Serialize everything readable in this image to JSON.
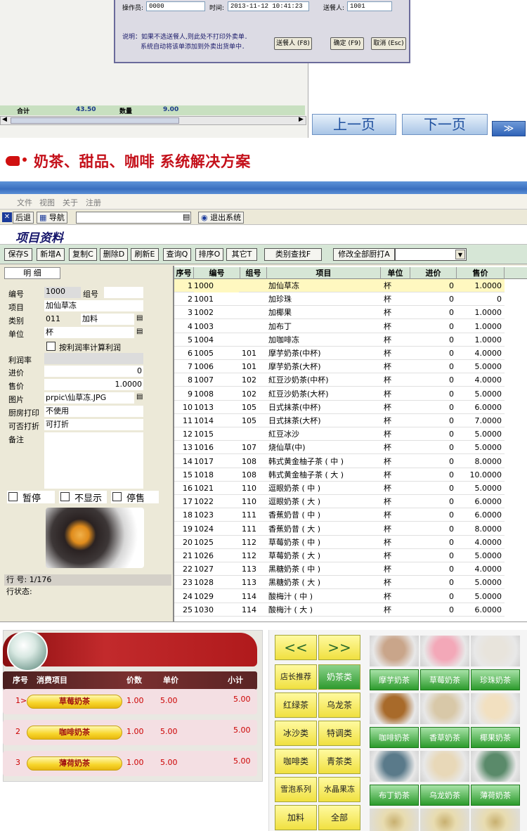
{
  "dialog": {
    "operator_label": "操作员:",
    "operator_value": "0000",
    "time_label": "时间:",
    "time_value": "2013-11-12 10:41:23",
    "waiter_label": "送餐人:",
    "waiter_value": "1001",
    "note_line1": "说明：如果不选送餐人,则此处不打印外卖单．",
    "note_line2": "系统自动将该单添加到外卖出货单中．",
    "btn_waiter": "送餐人 (F8)",
    "btn_ok": "确定 (F9)",
    "btn_cancel": "取消 (Esc)"
  },
  "summary": {
    "total_label": "合计",
    "total_value": "43.50",
    "qty_label": "数量",
    "qty_value": "9.00"
  },
  "paging": {
    "prev": "上一页",
    "next": "下一页",
    "expand": "≫"
  },
  "banner": {
    "title": "奶茶、甜品、咖啡  系统解决方案"
  },
  "menu": [
    "文件",
    "视图",
    "关于",
    "注册"
  ],
  "toolbar": {
    "back": "后退",
    "nav": "导航",
    "exit": "退出系统"
  },
  "page_title": "项目资料",
  "actions": [
    "保存S",
    "新增A",
    "复制C",
    "删除D",
    "刷新E",
    "查询Q",
    "排序O",
    "其它T"
  ],
  "category_search": "类别查找F",
  "modify_print": "修改全部厨打A",
  "form": {
    "tab": "明    细",
    "code_label": "编号",
    "code": "1000",
    "group_label": "组号",
    "item_label": "项目",
    "item": "加仙草冻",
    "type_label": "类别",
    "type_code": "011",
    "type_name": "加料",
    "unit_label": "单位",
    "unit": "杯",
    "profit_check": "按利润率计算利润",
    "margin_label": "利润率",
    "cost_label": "进价",
    "cost": "0",
    "price_label": "售价",
    "price": "1.0000",
    "image_label": "图片",
    "image": "prpic\\仙草冻.JPG",
    "kitchen_label": "厨房打印",
    "kitchen": "不使用",
    "discount_label": "可否打折",
    "discount": "可打折",
    "remark_label": "备注",
    "pause": "暂停",
    "hide": "不显示",
    "stop": "停售",
    "row_no": "行  号: 1/176",
    "row_state": "行状态:"
  },
  "grid": {
    "headers": [
      "序号",
      "编号",
      "组号",
      "项目",
      "单位",
      "进价",
      "售价"
    ],
    "rows": [
      [
        "1",
        "1000",
        "",
        "加仙草冻",
        "杯",
        "0",
        "1.0000"
      ],
      [
        "2",
        "1001",
        "",
        "加珍珠",
        "杯",
        "0",
        "0"
      ],
      [
        "3",
        "1002",
        "",
        "加椰果",
        "杯",
        "0",
        "1.0000"
      ],
      [
        "4",
        "1003",
        "",
        "加布丁",
        "杯",
        "0",
        "1.0000"
      ],
      [
        "5",
        "1004",
        "",
        "加咖啡冻",
        "杯",
        "0",
        "1.0000"
      ],
      [
        "6",
        "1005",
        "101",
        "摩芋奶茶(中杯)",
        "杯",
        "0",
        "4.0000"
      ],
      [
        "7",
        "1006",
        "101",
        "摩芋奶茶(大杯)",
        "杯",
        "0",
        "5.0000"
      ],
      [
        "8",
        "1007",
        "102",
        "紅豆沙奶茶(中杯)",
        "杯",
        "0",
        "4.0000"
      ],
      [
        "9",
        "1008",
        "102",
        "紅豆沙奶茶(大杯)",
        "杯",
        "0",
        "5.0000"
      ],
      [
        "10",
        "1013",
        "105",
        "日式抹茶(中杯)",
        "杯",
        "0",
        "6.0000"
      ],
      [
        "11",
        "1014",
        "105",
        "日式抹茶(大杯)",
        "杯",
        "0",
        "7.0000"
      ],
      [
        "12",
        "1015",
        "",
        "紅豆冰沙",
        "杯",
        "0",
        "5.0000"
      ],
      [
        "13",
        "1016",
        "107",
        "烧仙草(中)",
        "杯",
        "0",
        "5.0000"
      ],
      [
        "14",
        "1017",
        "108",
        "韩式黄金柚子茶 ( 中 )",
        "杯",
        "0",
        "8.0000"
      ],
      [
        "15",
        "1018",
        "108",
        "韩式黄金柚子茶 ( 大 )",
        "杯",
        "0",
        "10.0000"
      ],
      [
        "16",
        "1021",
        "110",
        "逗眼奶茶 ( 中 )",
        "杯",
        "0",
        "5.0000"
      ],
      [
        "17",
        "1022",
        "110",
        "逗眼奶茶 ( 大 )",
        "杯",
        "0",
        "6.0000"
      ],
      [
        "18",
        "1023",
        "111",
        "香蕉奶昔 ( 中 )",
        "杯",
        "0",
        "6.0000"
      ],
      [
        "19",
        "1024",
        "111",
        "香蕉奶昔 ( 大 )",
        "杯",
        "0",
        "8.0000"
      ],
      [
        "20",
        "1025",
        "112",
        "草莓奶茶 ( 中 )",
        "杯",
        "0",
        "4.0000"
      ],
      [
        "21",
        "1026",
        "112",
        "草莓奶茶 ( 大 )",
        "杯",
        "0",
        "5.0000"
      ],
      [
        "22",
        "1027",
        "113",
        "黑糖奶茶 ( 中 )",
        "杯",
        "0",
        "4.0000"
      ],
      [
        "23",
        "1028",
        "113",
        "黑糖奶茶 ( 大 )",
        "杯",
        "0",
        "5.0000"
      ],
      [
        "24",
        "1029",
        "114",
        "酸梅汁 ( 中 )",
        "杯",
        "0",
        "5.0000"
      ],
      [
        "25",
        "1030",
        "114",
        "酸梅汁 ( 大 )",
        "杯",
        "0",
        "6.0000"
      ]
    ]
  },
  "pos": {
    "headers": {
      "no": "序号",
      "item": "消费项目",
      "price": "价数",
      "unit": "单价",
      "subtotal": "小计"
    },
    "orders": [
      {
        "no": "1>",
        "name": "草莓奶茶",
        "qty": "1.00",
        "price": "5.00",
        "subtotal": "5.00"
      },
      {
        "no": "2",
        "name": "咖啡奶茶",
        "qty": "1.00",
        "price": "5.00",
        "subtotal": "5.00"
      },
      {
        "no": "3",
        "name": "薄荷奶茶",
        "qty": "1.00",
        "price": "5.00",
        "subtotal": "5.00"
      }
    ],
    "nav_prev": "<<",
    "nav_next": ">>",
    "categories": [
      "店长推荐",
      "奶茶类",
      "红绿茶",
      "乌龙茶",
      "冰沙类",
      "特调类",
      "咖啡类",
      "青茶类",
      "雪泡系列",
      "水晶果冻",
      "加料",
      "全部"
    ],
    "products": [
      "摩芋奶茶",
      "草莓奶茶",
      "珍珠奶茶",
      "咖啡奶茶",
      "香草奶茶",
      "椰果奶茶",
      "布丁奶茶",
      "乌龙奶茶",
      "薄荷奶茶"
    ],
    "product_colors": [
      "#c9a58a",
      "#f3a8b8",
      "#e8e4dc",
      "#a86a2a",
      "#d8c8a8",
      "#f2e0c0",
      "#5a7a8a",
      "#e8d8b8",
      "#5a8a6a"
    ]
  }
}
